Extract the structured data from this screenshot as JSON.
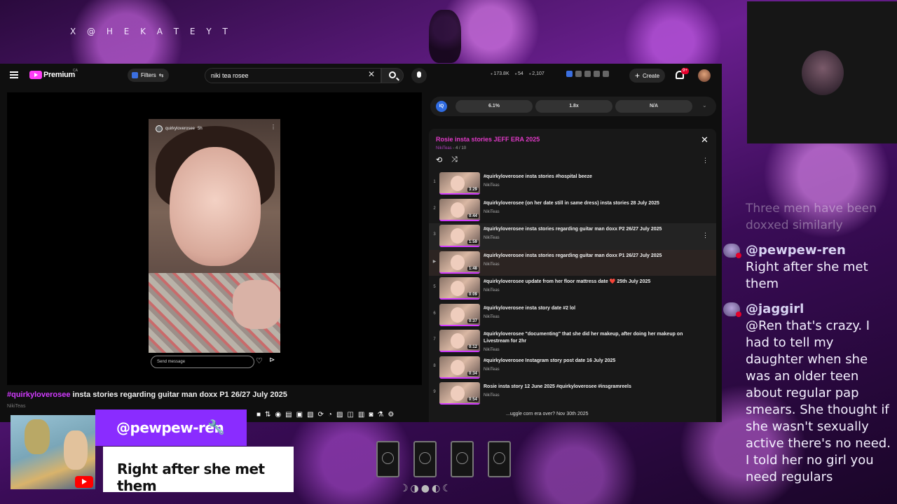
{
  "stream": {
    "handle": "X @ H E K A T E Y T"
  },
  "header": {
    "brand": "Premium",
    "brand_sup": "CA",
    "filters_label": "Filters",
    "search_value": "niki tea rosee",
    "stats": [
      "173.8K",
      "54",
      "2,107"
    ],
    "create_label": "Create",
    "notif_count": "9+"
  },
  "player": {
    "story_username": "quirkyloverosee",
    "story_time": "5h",
    "story_send_placeholder": "Send message",
    "title_tag": "#quirkyloverosee",
    "title_rest": " insta stories regarding guitar man doxx P1 26/27 July 2025",
    "under_title": "NikiTeas"
  },
  "ext_bar": {
    "pills": [
      "6.1%",
      "1.8x",
      "N/A"
    ]
  },
  "playlist": {
    "title": "Rosie insta stories JEFF ERA 2025",
    "channel": "NikiTeas",
    "position": " - 4 / 10",
    "items": [
      {
        "index": "1",
        "duration": "3:29",
        "title": "#quirkyloverosee insta stories #hospital beeze",
        "channel": "NikiTeas"
      },
      {
        "index": "2",
        "duration": "0:44",
        "title": "#quirkyloverosee (on her date still in same dress) insta stories 28 July 2025",
        "channel": "NikiTeas"
      },
      {
        "index": "3",
        "duration": "1:59",
        "title": "#quirkyloverosee insta stories regarding guitar man doxx P2 26/27 July 2025",
        "channel": "NikiTeas"
      },
      {
        "index": "▶",
        "duration": "1:48",
        "title": "#quirkyloverosee insta stories regarding guitar man doxx P1 26/27 July 2025",
        "channel": "NikiTeas"
      },
      {
        "index": "5",
        "duration": "0:09",
        "title": "#quirkyloverosee update from her floor mattress date ❤️ 25th July 2025",
        "channel": "NikiTeas"
      },
      {
        "index": "6",
        "duration": "0:37",
        "title": "#quirkyloverosee insta story date #2 lol",
        "channel": "NikiTeas"
      },
      {
        "index": "7",
        "duration": "0:12",
        "title": "#quirkyloverosee \"documenting\" that she did her makeup, after doing her makeup on Livestream for 2hr",
        "channel": "NikiTeas"
      },
      {
        "index": "8",
        "duration": "0:34",
        "title": "#quirkyloverosee Instagram story post date 16 July 2025",
        "channel": "NikiTeas"
      },
      {
        "index": "9",
        "duration": "0:54",
        "title": "Rosie insta story 12 June 2025 #quirkyloverosee #insgramreels",
        "channel": "NikiTeas"
      }
    ],
    "footer": "...uggle corn era over? Nov 30th 2025"
  },
  "chat": {
    "faded": "Three men have been doxxed similarly",
    "messages": [
      {
        "name": "@pewpew-ren",
        "text": "Right after she met them"
      },
      {
        "name": "@jaggirl",
        "text": "@Ren that's crazy. I had to tell my daughter when she was an older teen about regular pap smears. She thought if she wasn't sexually active there's no need. I told her no girl you need regulars"
      }
    ]
  },
  "highlight": {
    "name": "@pewpew-ren",
    "text": "Right after she met them"
  },
  "icons": [
    "menu-icon",
    "search-icon",
    "mic-icon",
    "bell-icon",
    "close-icon",
    "loop-icon",
    "shuffle-icon",
    "more-vert-icon",
    "heart-icon",
    "share-icon",
    "wrench-icon",
    "youtube-icon"
  ],
  "colors": {
    "accent": "#d23bff",
    "brand": "#ff3df7",
    "highlight_bg": "#8a2cff"
  }
}
